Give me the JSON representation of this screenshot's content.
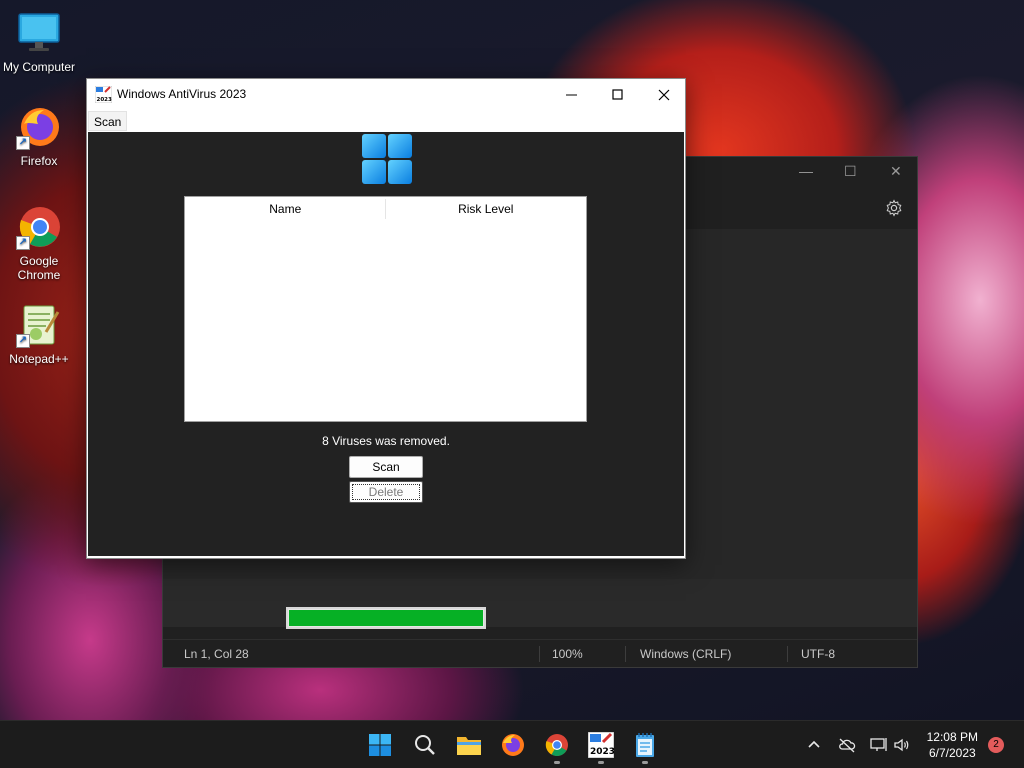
{
  "desktop": {
    "icons": [
      {
        "label": "My Computer"
      },
      {
        "label": "Firefox"
      },
      {
        "label": "Google Chrome"
      },
      {
        "label": "Notepad++"
      }
    ]
  },
  "notepad": {
    "status": {
      "position": "Ln 1, Col 28",
      "zoom": "100%",
      "line_ending": "Windows (CRLF)",
      "encoding": "UTF-8"
    }
  },
  "antivirus": {
    "title": "Windows AntiVirus 2023",
    "icon_badge": "2023",
    "menu": [
      "Scan"
    ],
    "table": {
      "columns": [
        "Name",
        "Risk Level"
      ],
      "rows": []
    },
    "status_message": "8 Viruses was removed.",
    "scan_button": "Scan",
    "delete_button": "Delete",
    "progress_percent": 100,
    "colors": {
      "progress": "#06b025"
    }
  },
  "taskbar": {
    "apps": [
      "start-icon",
      "search-icon",
      "file-explorer-icon",
      "firefox-icon",
      "chrome-icon",
      "antivirus-2023-icon",
      "notepad-icon"
    ],
    "antivirus_badge": "2023",
    "clock": {
      "time": "12:08 PM",
      "date": "6/7/2023"
    },
    "notifications": "2"
  }
}
